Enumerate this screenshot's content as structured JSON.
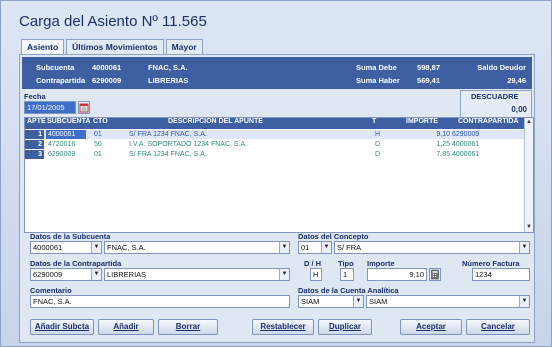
{
  "window": {
    "title": "Carga del Asiento Nº 11.565"
  },
  "tabs": [
    {
      "label": "Asiento"
    },
    {
      "label": "Últimos Movimientos"
    },
    {
      "label": "Mayor"
    }
  ],
  "info": {
    "subcuenta_label": "Subcuenta",
    "subcuenta_code": "4000061",
    "subcuenta_name": "FNAC, S.A.",
    "contrapartida_label": "Contrapartida",
    "contrapartida_code": "6290009",
    "contrapartida_name": "LIBRERIAS",
    "suma_debe_label": "Suma Debe",
    "suma_debe_value": "598,87",
    "suma_haber_label": "Suma Haber",
    "suma_haber_value": "569,41",
    "saldo_label": "Saldo Deudor",
    "saldo_value": "29,46"
  },
  "fecha": {
    "label": "Fecha",
    "value": "17/01/2005"
  },
  "descuadre": {
    "label": "DESCUADRE",
    "value": "0,00"
  },
  "grid": {
    "headers": [
      "APTE",
      "SUBCUENTA",
      "CTO",
      "DESCRIPCIÓN DEL APUNTE",
      "T",
      "IMPORTE",
      "CONTRAPARTIDA"
    ],
    "rows": [
      {
        "apte": "1",
        "subcuenta": "4000061",
        "cto": "01",
        "descripcion": "S/ FRA 1234 FNAC, S.A.",
        "t": "H",
        "importe": "9,10",
        "contrapartida": "6290009"
      },
      {
        "apte": "2",
        "subcuenta": "4720016",
        "cto": "50",
        "descripcion": "I.V.A. SOPORTADO 1234 FNAC, S.A.",
        "t": "D",
        "importe": "1,25",
        "contrapartida": "4000061"
      },
      {
        "apte": "3",
        "subcuenta": "6290009",
        "cto": "01",
        "descripcion": "S/ FRA 1234 FNAC, S.A.",
        "t": "D",
        "importe": "7,85",
        "contrapartida": "4000061"
      }
    ]
  },
  "form": {
    "datos_subcuenta_label": "Datos de la Subcuenta",
    "subcuenta_code": "4000061",
    "subcuenta_name": "FNAC, S.A.",
    "datos_concepto_label": "Datos del Concepto",
    "concepto_code": "01",
    "concepto_name": "S/ FRA",
    "datos_contrapartida_label": "Datos de la Contrapartida",
    "contrapartida_code": "6290009",
    "contrapartida_name": "LIBRERIAS",
    "dh_label": "D / H",
    "dh_value": "H",
    "tipo_label": "Tipo",
    "tipo_value": "1",
    "importe_label": "Importe",
    "importe_value": "9,10",
    "numero_factura_label": "Número Factura",
    "numero_factura_value": "1234",
    "comentario_label": "Comentario",
    "comentario_value": "FNAC, S.A.",
    "analitica_label": "Datos de la Cuenta Analítica",
    "analitica_code": "SIAM",
    "analitica_name": "SIAM"
  },
  "buttons": {
    "anadir_subcta": "Añadir Subcta",
    "anadir": "Añadir",
    "borrar": "Borrar",
    "restablecer": "Restablecer",
    "duplicar": "Duplicar",
    "aceptar": "Aceptar",
    "cancelar": "Cancelar"
  },
  "colors": {
    "header_bar": "#3f5fa3",
    "title": "#1b2f6b",
    "selected_cell": "#3d6ec9"
  },
  "icons": {
    "date_picker": "calendar-icon",
    "importe": "calculator-icon",
    "dropdown": "chevron-down-icon"
  }
}
